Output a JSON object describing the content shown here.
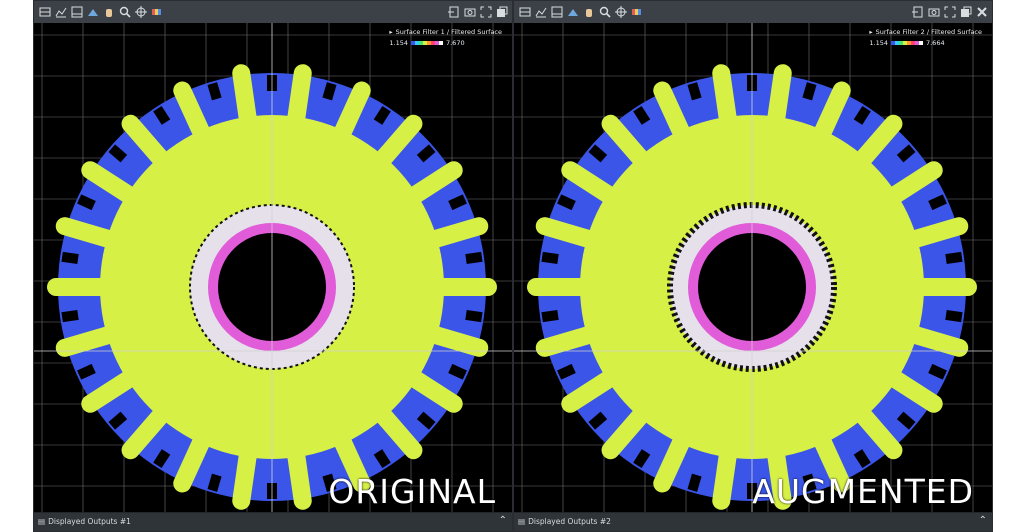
{
  "colors": {
    "gear": "#d7f046",
    "teeth": "#3a55e8",
    "ring_white": "#e6e0ea",
    "ring_pink": "#e05cd8",
    "grid": "#707070",
    "background": "#000000"
  },
  "toolbar": {
    "left_icons": [
      "3d-view-icon",
      "profile-icon",
      "section-icon",
      "surface-icon",
      "hand-icon",
      "zoom-icon",
      "target-icon",
      "palette-icon"
    ],
    "right_icons_left": [
      "dock-icon",
      "camera-icon",
      "fullscreen-icon",
      "undock-icon"
    ],
    "right_icons_right": [
      "dock-icon",
      "camera-icon",
      "fullscreen-icon",
      "undock-icon",
      "close-icon"
    ]
  },
  "panels": {
    "left": {
      "legend_title": "Surface Filter 1 / Filtered Surface",
      "legend_min": "1.154",
      "legend_max": "7.670",
      "overlay_label": "ORIGINAL",
      "status_text": "Displayed Outputs #1"
    },
    "right": {
      "legend_title": "Surface Filter 2 / Filtered Surface",
      "legend_min": "1.154",
      "legend_max": "7.664",
      "overlay_label": "AUGMENTED",
      "status_text": "Displayed Outputs #2"
    }
  },
  "legend_swatches": [
    "#3a55e8",
    "#38c8ff",
    "#3ae86a",
    "#d7f046",
    "#ff9a30",
    "#ff4070",
    "#e05cd8",
    "#ffffff"
  ]
}
